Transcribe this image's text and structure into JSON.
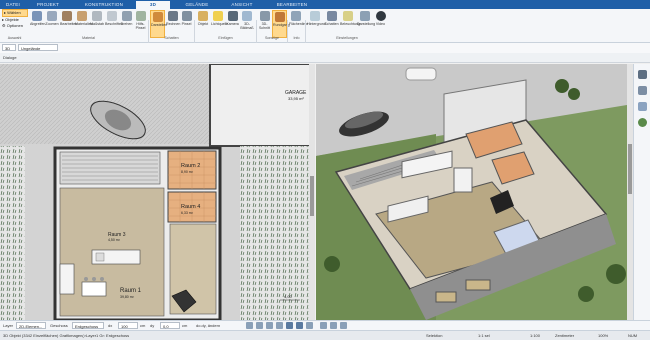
{
  "menu": {
    "tabs": [
      {
        "label": "DATEI"
      },
      {
        "label": "PROJEKT"
      },
      {
        "label": "KONSTRUKTION"
      },
      {
        "label": "3D",
        "active": true
      },
      {
        "label": "GELÄNDE"
      },
      {
        "label": "ANSICHT"
      },
      {
        "label": "BEARBEITEN"
      }
    ]
  },
  "ribbon": {
    "left_items": [
      "Wählen",
      "Objekte",
      "Optionen"
    ],
    "buttons": [
      "Abgreifen",
      "Zoomen",
      "Bearbeiten",
      "Materialien",
      "Maßstab",
      "Beschriften",
      "Drehen",
      "Hilfs-Pinsel",
      "Darstellen",
      "Rechnen",
      "Pinsel",
      "Objekt",
      "Lichtquelle",
      "Kamera",
      "3D-Bildmaß",
      "3D-Schnitt",
      "Rundgang",
      "Flächenlinie",
      "Hintergrund",
      "Schatten",
      "Beleuchtung",
      "Darstellung",
      "Video"
    ],
    "groups": [
      "Auswahl",
      "Material",
      "Schatten",
      "Einfügen",
      "Sonstige",
      "Info",
      "Einstellungen"
    ]
  },
  "toolbar2": {
    "view_select": "3D",
    "mode_select": "Ungelände"
  },
  "dialog_label": "Dialoge",
  "plan": {
    "rooms": [
      {
        "name": "Raum 1",
        "area": "39,80 m²"
      },
      {
        "name": "Raum 2",
        "area": "8,90 m²"
      },
      {
        "name": "Raum 3",
        "area": "4,50 m²"
      },
      {
        "name": "Raum 4",
        "area": "6,33 m²"
      }
    ],
    "garage_label": "GARAGE",
    "garage_area": "33,95 m²",
    "dim_label": "4,00"
  },
  "bottom": {
    "layer_label": "Layer",
    "layer_value": "2D-Elemen...",
    "floor_label": "Geschoss",
    "floor_value": "Erdgeschoss",
    "dx_label": "dx",
    "dx_value": "100",
    "dx_unit": "cm",
    "dy_label": "dy",
    "dy_value": "0,0",
    "dy_unit": "cm",
    "angle_label": "do.dy, ändern"
  },
  "status": {
    "left": "3D Objekt (3342 Einzelflächen) Grafikmagen(>Layer1 Gr: Erdgeschoss",
    "mode": "Selektion",
    "ratio": "1:1 sel",
    "scale": "1:100",
    "unit": "Zentimeter",
    "zoom": "100%",
    "keyboard": "NUM"
  },
  "colors": {
    "accent": "#1f5fa8",
    "highlight": "#ffd98e"
  }
}
